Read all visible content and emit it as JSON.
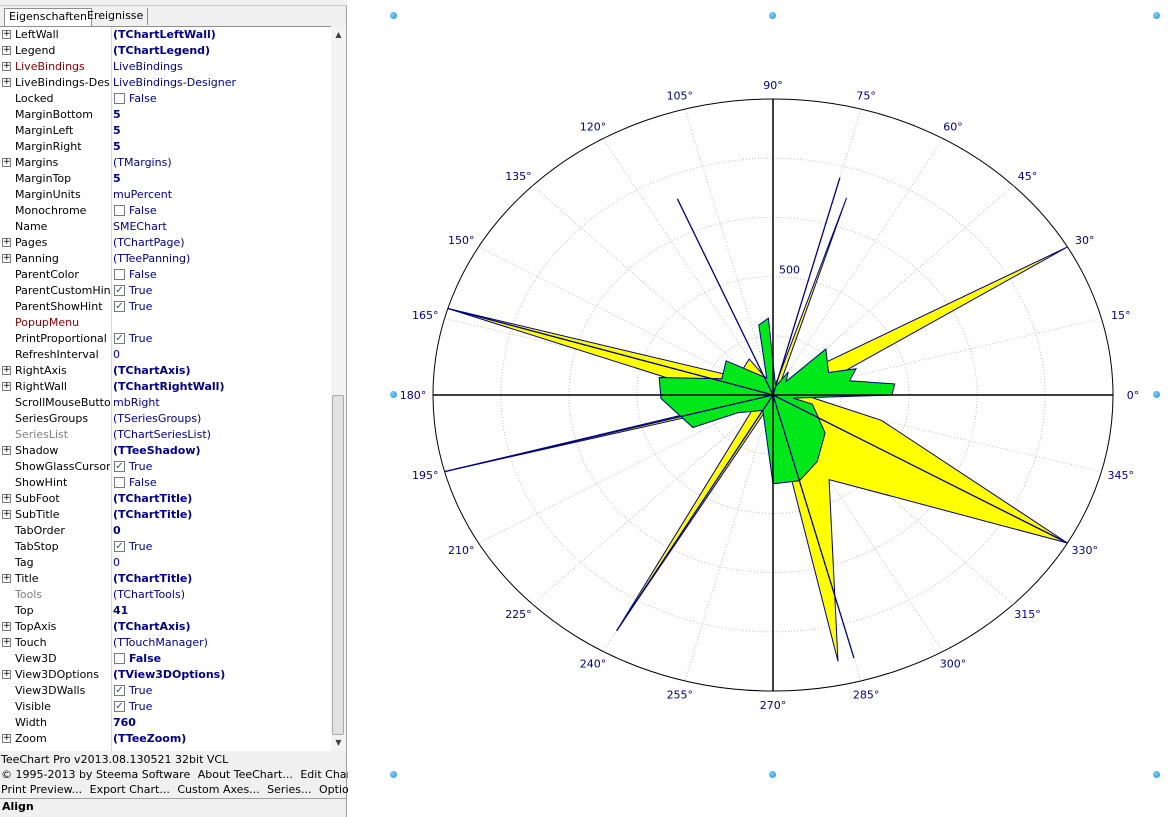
{
  "tabs": [
    {
      "label": "Eigenschaften",
      "active": true
    },
    {
      "label": "Ereignisse",
      "active": false
    }
  ],
  "properties": [
    {
      "name": "LeftWall",
      "value": "(TChartLeftWall)",
      "bold": true,
      "expandable": true
    },
    {
      "name": "Legend",
      "value": "(TChartLegend)",
      "bold": true,
      "expandable": true
    },
    {
      "name": "LiveBindings",
      "value": "LiveBindings",
      "expandable": true,
      "kind": "events"
    },
    {
      "name": "LiveBindings-Designer",
      "value": "LiveBindings-Designer",
      "expandable": true
    },
    {
      "name": "Locked",
      "value": "False",
      "checkbox": false
    },
    {
      "name": "MarginBottom",
      "value": "5",
      "bold": true
    },
    {
      "name": "MarginLeft",
      "value": "5",
      "bold": true
    },
    {
      "name": "MarginRight",
      "value": "5",
      "bold": true
    },
    {
      "name": "Margins",
      "value": "(TMargins)",
      "expandable": true
    },
    {
      "name": "MarginTop",
      "value": "5",
      "bold": true
    },
    {
      "name": "MarginUnits",
      "value": "muPercent"
    },
    {
      "name": "Monochrome",
      "value": "False",
      "checkbox": false
    },
    {
      "name": "Name",
      "value": "SMEChart"
    },
    {
      "name": "Pages",
      "value": "(TChartPage)",
      "expandable": true
    },
    {
      "name": "Panning",
      "value": "(TTeePanning)",
      "expandable": true
    },
    {
      "name": "ParentColor",
      "value": "False",
      "checkbox": false
    },
    {
      "name": "ParentCustomHint",
      "value": "True",
      "checkbox": true
    },
    {
      "name": "ParentShowHint",
      "value": "True",
      "checkbox": true
    },
    {
      "name": "PopupMenu",
      "value": "",
      "kind": "events"
    },
    {
      "name": "PrintProportional",
      "value": "True",
      "checkbox": true
    },
    {
      "name": "RefreshInterval",
      "value": "0"
    },
    {
      "name": "RightAxis",
      "value": "(TChartAxis)",
      "bold": true,
      "expandable": true
    },
    {
      "name": "RightWall",
      "value": "(TChartRightWall)",
      "bold": true,
      "expandable": true
    },
    {
      "name": "ScrollMouseButton",
      "value": "mbRight"
    },
    {
      "name": "SeriesGroups",
      "value": "(TSeriesGroups)"
    },
    {
      "name": "SeriesList",
      "value": "(TChartSeriesList)",
      "kind": "ro"
    },
    {
      "name": "Shadow",
      "value": "(TTeeShadow)",
      "bold": true,
      "expandable": true
    },
    {
      "name": "ShowGlassCursor",
      "value": "True",
      "checkbox": true
    },
    {
      "name": "ShowHint",
      "value": "False",
      "checkbox": false
    },
    {
      "name": "SubFoot",
      "value": "(TChartTitle)",
      "bold": true,
      "expandable": true
    },
    {
      "name": "SubTitle",
      "value": "(TChartTitle)",
      "bold": true,
      "expandable": true
    },
    {
      "name": "TabOrder",
      "value": "0",
      "bold": true
    },
    {
      "name": "TabStop",
      "value": "True",
      "checkbox": true
    },
    {
      "name": "Tag",
      "value": "0"
    },
    {
      "name": "Title",
      "value": "(TChartTitle)",
      "bold": true,
      "expandable": true
    },
    {
      "name": "Tools",
      "value": "(TChartTools)",
      "kind": "ro"
    },
    {
      "name": "Top",
      "value": "41",
      "bold": true
    },
    {
      "name": "TopAxis",
      "value": "(TChartAxis)",
      "bold": true,
      "expandable": true
    },
    {
      "name": "Touch",
      "value": "(TTouchManager)",
      "expandable": true
    },
    {
      "name": "View3D",
      "value": "False",
      "bold": true,
      "checkbox": false
    },
    {
      "name": "View3DOptions",
      "value": "(TView3DOptions)",
      "bold": true,
      "expandable": true
    },
    {
      "name": "View3DWalls",
      "value": "True",
      "checkbox": true
    },
    {
      "name": "Visible",
      "value": "True",
      "checkbox": true
    },
    {
      "name": "Width",
      "value": "760",
      "bold": true
    },
    {
      "name": "Zoom",
      "value": "(TTeeZoom)",
      "bold": true,
      "expandable": true
    }
  ],
  "verbs": {
    "version": "TeeChart Pro v2013.08.130521 32bit VCL",
    "copyright": "© 1995-2013 by Steema Software",
    "about": "About TeeChart...",
    "edit": "Edit Chart...",
    "print_preview": "Print Preview...",
    "export": "Export Chart...",
    "custom_axes": "Custom Axes...",
    "series": "Series...",
    "options": "Options..."
  },
  "status": "Align",
  "colors": {
    "yellow_series": "#ffff00",
    "green_series": "#00e81a",
    "series_border": "#000080",
    "axis": "#000000",
    "grid": "#c0c0c0",
    "label": "#000080"
  },
  "chart_data": {
    "type": "polar",
    "radial_label": "500",
    "angle_labels": [
      "0°",
      "15°",
      "30°",
      "45°",
      "60°",
      "75°",
      "90°",
      "105°",
      "120°",
      "135°",
      "150°",
      "165°",
      "180°",
      "195°",
      "210°",
      "225°",
      "240°",
      "255°",
      "270°",
      "285°",
      "300°",
      "315°",
      "330°",
      "345°"
    ],
    "series": [
      {
        "color": "#ffff00",
        "points": [
          {
            "angle": 0,
            "r": 100
          },
          {
            "angle": 8,
            "r": 120
          },
          {
            "angle": 16,
            "r": 160
          },
          {
            "angle": 30,
            "r": 1000
          },
          {
            "angle": 45,
            "r": 80
          },
          {
            "angle": 60,
            "r": 40
          },
          {
            "angle": 72,
            "r": 700
          },
          {
            "angle": 75,
            "r": 60
          },
          {
            "angle": 90,
            "r": 20
          },
          {
            "angle": 100,
            "r": 40
          },
          {
            "angle": 120,
            "r": 140
          },
          {
            "angle": 150,
            "r": 120
          },
          {
            "angle": 163,
            "r": 1000
          },
          {
            "angle": 172,
            "r": 250
          },
          {
            "angle": 190,
            "r": 60
          },
          {
            "angle": 195,
            "r": 1000
          },
          {
            "angle": 205,
            "r": 50
          },
          {
            "angle": 240,
            "r": 920
          },
          {
            "angle": 255,
            "r": 30
          },
          {
            "angle": 270,
            "r": 40
          },
          {
            "angle": 282,
            "r": 920
          },
          {
            "angle": 300,
            "r": 330
          },
          {
            "angle": 330,
            "r": 1000
          },
          {
            "angle": 345,
            "r": 330
          },
          {
            "angle": 355,
            "r": 120
          }
        ]
      },
      {
        "color": "#00e81a",
        "points": [
          {
            "angle": 0,
            "r": 350
          },
          {
            "angle": 6,
            "r": 360
          },
          {
            "angle": 12,
            "r": 230
          },
          {
            "angle": 20,
            "r": 260
          },
          {
            "angle": 25,
            "r": 180
          },
          {
            "angle": 45,
            "r": 220
          },
          {
            "angle": 50,
            "r": 60
          },
          {
            "angle": 60,
            "r": 90
          },
          {
            "angle": 75,
            "r": 30
          },
          {
            "angle": 93,
            "r": 260
          },
          {
            "angle": 100,
            "r": 240
          },
          {
            "angle": 108,
            "r": 60
          },
          {
            "angle": 140,
            "r": 180
          },
          {
            "angle": 160,
            "r": 160
          },
          {
            "angle": 170,
            "r": 340
          },
          {
            "angle": 182,
            "r": 330
          },
          {
            "angle": 205,
            "r": 260
          },
          {
            "angle": 210,
            "r": 120
          },
          {
            "angle": 240,
            "r": 60
          },
          {
            "angle": 270,
            "r": 300
          },
          {
            "angle": 285,
            "r": 300
          },
          {
            "angle": 300,
            "r": 260
          },
          {
            "angle": 320,
            "r": 200
          },
          {
            "angle": 345,
            "r": 120
          },
          {
            "angle": 350,
            "r": 60
          }
        ]
      }
    ],
    "spikes": [
      {
        "angle": 75,
        "r": 760
      },
      {
        "angle": 113,
        "r": 720
      },
      {
        "angle": 163,
        "r": 1000
      },
      {
        "angle": 195,
        "r": 1000
      },
      {
        "angle": 240,
        "r": 920
      },
      {
        "angle": 285,
        "r": 920
      },
      {
        "angle": 330,
        "r": 1000
      }
    ]
  }
}
